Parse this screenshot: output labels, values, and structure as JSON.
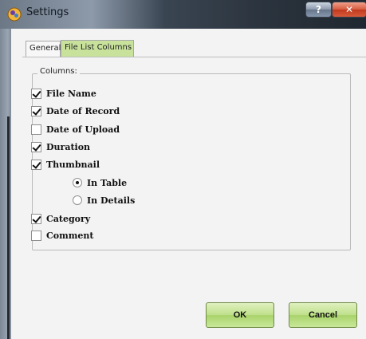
{
  "window": {
    "title": "Settings",
    "help_label": "?",
    "close_label": "✕"
  },
  "tabs": [
    {
      "label": "General",
      "active": false
    },
    {
      "label": "File List Columns",
      "active": true
    }
  ],
  "columns_group": {
    "label": "Columns:",
    "options": [
      {
        "label": "File Name",
        "type": "checkbox",
        "checked": true
      },
      {
        "label": "Date of Record",
        "type": "checkbox",
        "checked": true
      },
      {
        "label": "Date of Upload",
        "type": "checkbox",
        "checked": false
      },
      {
        "label": "Duration",
        "type": "checkbox",
        "checked": true
      },
      {
        "label": "Thumbnail",
        "type": "checkbox",
        "checked": true
      },
      {
        "label": "In Table",
        "type": "radio",
        "checked": true
      },
      {
        "label": "In Details",
        "type": "radio",
        "checked": false
      },
      {
        "label": "Category",
        "type": "checkbox",
        "checked": true
      },
      {
        "label": "Comment",
        "type": "checkbox",
        "checked": false
      }
    ]
  },
  "buttons": {
    "ok": "OK",
    "cancel": "Cancel"
  },
  "colors": {
    "accent_green": "#c8e29c",
    "button_green": "#a9d36a"
  }
}
